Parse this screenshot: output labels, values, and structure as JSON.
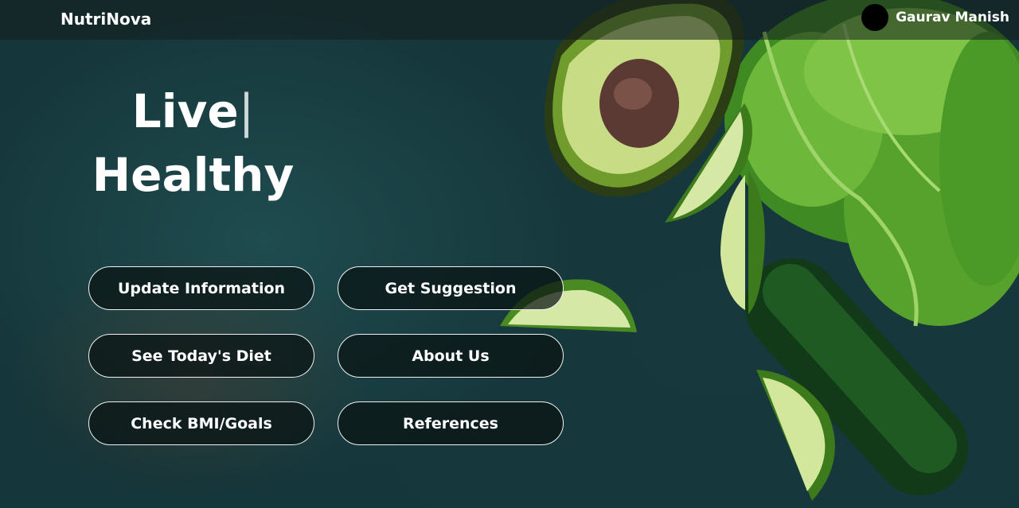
{
  "header": {
    "brand": "NutriNova",
    "user_name": "Gaurav Manish"
  },
  "hero": {
    "line1": "Live",
    "cursor": "|",
    "line2": "Healthy"
  },
  "actions": {
    "update_information": "Update Information",
    "get_suggestion": "Get Suggestion",
    "see_todays_diet": "See Today's Diet",
    "about_us": "About Us",
    "check_bmi_goals": "Check BMI/Goals",
    "references": "References"
  },
  "colors": {
    "background": "#15363a",
    "avocado": "#8fbf3a",
    "lettuce": "#5fa331",
    "lime": "#cfe59a",
    "button_border": "#f2f2f2"
  },
  "icons": {
    "avatar": "avatar-circle"
  }
}
